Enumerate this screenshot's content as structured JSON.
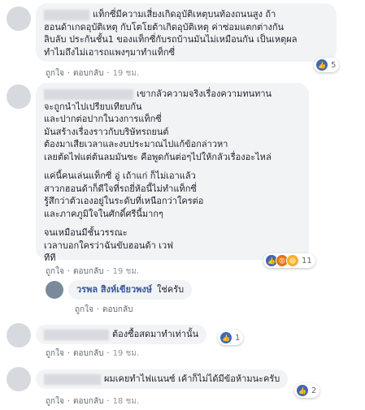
{
  "actions": {
    "like": "ถูกใจ",
    "reply": "ตอบกลับ"
  },
  "comments": [
    {
      "lines": [
        "แท็กซี่มีความเสี่ยงเกิดอุบัติเหตุบนท้องถนนสูง ถ้า",
        "ฮอนด้าเกดอุบัติเหตุ กับโตโยต้าเกิดอุบัติเหตุ ค่าซ่อมแตกต่างกัน",
        "ลิบลับ ประกันชั้น1 ของแท็กซี่กับรถบ้านมันไม่เหมือนกัน เป็นเหตุผล",
        "ทำไมถึงไม่เอารถแพงๆมาทำแท็กซี่"
      ],
      "time": "19 ชม.",
      "reaction_count": "5"
    },
    {
      "lines": [
        "เขากลัวความจริงเรื่องความทนทาน",
        "จะถูกนำไปเปรียบเทียบกัน",
        "และปากต่อปากในวงการแท็กซี่",
        "มันสร้างเรื่องราวกับบริษัทรถยนต์",
        "ต้องมาเสียเวลาและงบประมาณไปแก้ข้อกล่าวหา",
        "เลยตัดไฟแต่ต้นลมมันซะ คือพูดกันต่อๆไปให้กลัวเรื่องอะไหล่",
        "",
        "แค่นี้คนเล่นแท็กซี่ อู่ เถ้าแก่ ก็ไม่เอาแล้ว",
        "สาวกฮอนด้าก็ดีใจที่รถยี่ห้อนี้ไม่ทำแท็กซี่",
        "รู้สึกว่าตัวเองอยู่ในระดับที่เหนือกว่าใครต่อ",
        "และภาคภูมิใจในศักดิ์ศรีนี้มากๆ",
        "",
        "จนเหมือนมีชั้นวรรณะ",
        "เวลาบอกใครว่าฉันขับฮอนด้า เวฟ",
        "ทีที"
      ],
      "time": "19 ชม.",
      "reaction_count": "11"
    },
    {
      "name": "วรพล สิงห์เขียวพงษ์",
      "text": "ใช่ครับ"
    },
    {
      "text": "ต้องซื้อสดมาทำเท่านั้น",
      "time": "19 ชม.",
      "reaction_count": "1"
    },
    {
      "text": "ผมเคยทำไฟแนนซ์ เค้าก็ไม่ได้มีข้อห้ามนะครับ",
      "time": "18 ชม.",
      "reaction_count": "2"
    }
  ]
}
